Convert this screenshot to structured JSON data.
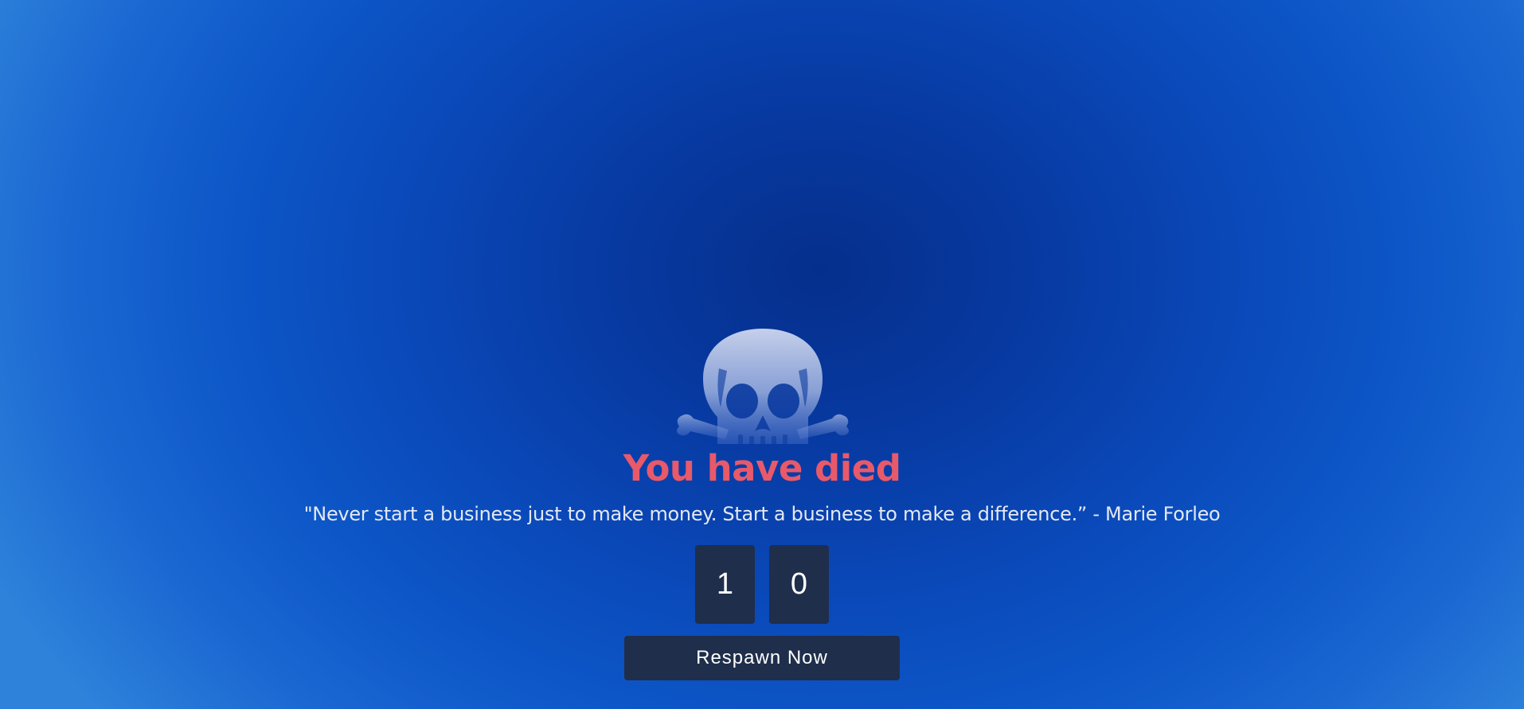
{
  "death_screen": {
    "title": "You have died",
    "quote": "\"Never start a business just to make money. Start a business to make a difference.” - Marie Forleo",
    "countdown_digits": [
      "1",
      "0"
    ],
    "respawn_label": "Respawn Now",
    "icon": "skull-crossbones-icon"
  },
  "colors": {
    "background_center": "#062f8c",
    "background_edge": "#2e82da",
    "title": "#e8596a",
    "panel": "#1f2e4b"
  }
}
